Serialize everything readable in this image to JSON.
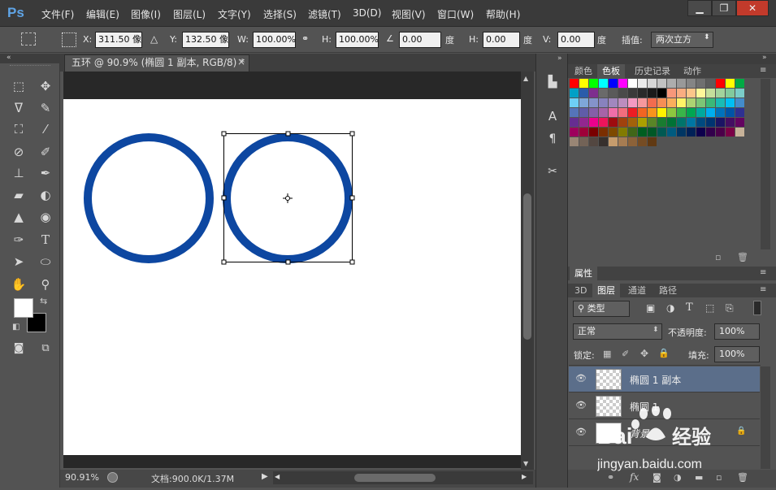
{
  "app": {
    "logo": "Ps"
  },
  "menu": [
    "文件(F)",
    "编辑(E)",
    "图像(I)",
    "图层(L)",
    "文字(Y)",
    "选择(S)",
    "滤镜(T)",
    "3D(D)",
    "视图(V)",
    "窗口(W)",
    "帮助(H)"
  ],
  "window_controls": {
    "minimize": "▁",
    "restore": "❐",
    "close": "✕"
  },
  "options": {
    "x_label": "X:",
    "x_value": "311.50 像",
    "y_label": "Y:",
    "y_value": "132.50 像",
    "w_label": "W:",
    "w_value": "100.00%",
    "h_label": "H:",
    "h_value": "100.00%",
    "angle_value": "0.00",
    "angle_unit": "度",
    "hskew_label": "H:",
    "hskew_value": "0.00",
    "hskew_unit": "度",
    "vskew_label": "V:",
    "vskew_value": "0.00",
    "vskew_unit": "度",
    "interp_label": "插值:",
    "interp_value": "两次立方"
  },
  "document": {
    "tab_title": "五环 @ 90.9% (椭圆 1 副本, RGB/8) *",
    "tab_close": "×"
  },
  "canvas": {
    "ring_color": "#0d47a1"
  },
  "status": {
    "zoom": "90.91%",
    "doc_info": "文档:900.0K/1.37M"
  },
  "panels": {
    "top_tabs": [
      "颜色",
      "色板",
      "历史记录",
      "动作"
    ],
    "top_active": 1,
    "properties_tab": "属性",
    "layer_tabs": [
      "3D",
      "图层",
      "通道",
      "路径"
    ],
    "layer_active": 1,
    "filter_label": "类型",
    "blend_mode": "正常",
    "opacity_label": "不透明度:",
    "opacity_value": "100%",
    "lock_label": "锁定:",
    "fill_label": "填充:",
    "fill_value": "100%",
    "layers": [
      {
        "name": "椭圆 1 副本",
        "selected": true
      },
      {
        "name": "椭圆 1",
        "selected": false
      },
      {
        "name": "背景",
        "selected": false,
        "locked": true
      }
    ]
  },
  "swatches": [
    [
      "#ff0000",
      "#ffff00",
      "#00ff00",
      "#00ffff",
      "#0000ff",
      "#ff00ff",
      "#ffffff",
      "#ebebeb",
      "#d6d6d6",
      "#c2c2c2",
      "#adadad",
      "#999999",
      "#858585",
      "#707070",
      "#5c5c5c",
      "#ff0000",
      "#ffff00",
      "#00aa44"
    ],
    [
      "#00a0c6",
      "#2a5caa",
      "#7e2e8e",
      "#6a6a6a",
      "#5a5a5a",
      "#4a4a4a",
      "#3a3a3a",
      "#2a2a2a",
      "#1a1a1a",
      "#000000",
      "#f7977a",
      "#f9ad81",
      "#fdc68a",
      "#fff79a",
      "#c4df9b",
      "#a2d39c",
      "#82ca9d",
      "#7bcdc8"
    ],
    [
      "#6ecff6",
      "#7ea7d8",
      "#8493ca",
      "#8882be",
      "#a187be",
      "#bc8dbf",
      "#f49ac2",
      "#f6989d",
      "#f26c4f",
      "#f68e55",
      "#fbaf5c",
      "#fff467",
      "#acd372",
      "#7cc576",
      "#3bb878",
      "#1abbb4",
      "#00bff3",
      "#438ccb"
    ],
    [
      "#5574b9",
      "#605ca8",
      "#855fa8",
      "#a763a8",
      "#f06ea9",
      "#f26d7d",
      "#ed1c24",
      "#f26522",
      "#f7941d",
      "#fff200",
      "#8dc73f",
      "#39b54a",
      "#00a651",
      "#00a99d",
      "#00aeef",
      "#0072bc",
      "#0054a6",
      "#2e3192"
    ],
    [
      "#662d91",
      "#92278f",
      "#ec008c",
      "#ed145b",
      "#9e0b0f",
      "#a0410d",
      "#a3620a",
      "#aba000",
      "#598527",
      "#197b30",
      "#007236",
      "#00746b",
      "#0076a3",
      "#004a80",
      "#003471",
      "#1b1464",
      "#440e62",
      "#630460"
    ],
    [
      "#9e005d",
      "#9e0039",
      "#790000",
      "#7b2e00",
      "#7d4900",
      "#827b00",
      "#406618",
      "#005e20",
      "#005826",
      "#005952",
      "#005b7f",
      "#003663",
      "#002157",
      "#0d004c",
      "#32004b",
      "#4b0049",
      "#7b0046",
      "#c7b299"
    ],
    [
      "#998675",
      "#736357",
      "#534741",
      "#37302d",
      "#c69c6d",
      "#a67c52",
      "#8c6239",
      "#754c24",
      "#603913"
    ]
  ]
}
